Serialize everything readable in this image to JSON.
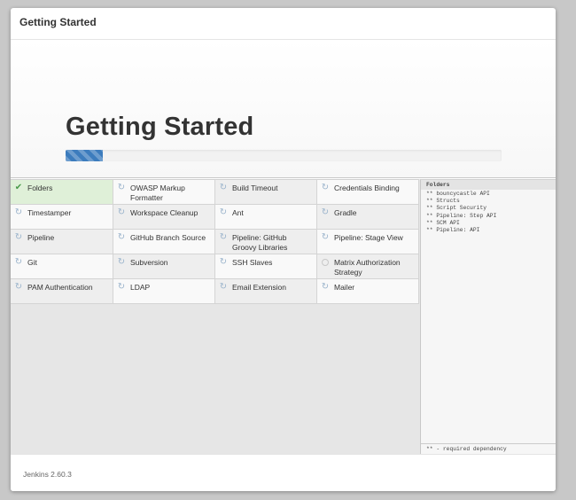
{
  "header": {
    "title": "Getting Started"
  },
  "hero": {
    "title": "Getting Started",
    "progress_fraction": 0.085
  },
  "plugins": [
    {
      "label": "Folders",
      "status": "done",
      "icon": "check-icon"
    },
    {
      "label": "OWASP Markup Formatter",
      "status": "installing",
      "icon": "refresh-icon"
    },
    {
      "label": "Build Timeout",
      "status": "installing",
      "icon": "refresh-icon"
    },
    {
      "label": "Credentials Binding",
      "status": "installing",
      "icon": "refresh-icon"
    },
    {
      "label": "Timestamper",
      "status": "installing",
      "icon": "refresh-icon"
    },
    {
      "label": "Workspace Cleanup",
      "status": "installing",
      "icon": "refresh-icon"
    },
    {
      "label": "Ant",
      "status": "installing",
      "icon": "refresh-icon"
    },
    {
      "label": "Gradle",
      "status": "installing",
      "icon": "refresh-icon"
    },
    {
      "label": "Pipeline",
      "status": "installing",
      "icon": "refresh-icon"
    },
    {
      "label": "GitHub Branch Source",
      "status": "installing",
      "icon": "refresh-icon"
    },
    {
      "label": "Pipeline: GitHub Groovy Libraries",
      "status": "installing",
      "icon": "refresh-icon"
    },
    {
      "label": "Pipeline: Stage View",
      "status": "installing",
      "icon": "refresh-icon"
    },
    {
      "label": "Git",
      "status": "installing",
      "icon": "refresh-icon"
    },
    {
      "label": "Subversion",
      "status": "installing",
      "icon": "refresh-icon"
    },
    {
      "label": "SSH Slaves",
      "status": "installing",
      "icon": "refresh-icon"
    },
    {
      "label": "Matrix Authorization Strategy",
      "status": "pending",
      "icon": "pending-circle-icon"
    },
    {
      "label": "PAM Authentication",
      "status": "installing",
      "icon": "refresh-icon"
    },
    {
      "label": "LDAP",
      "status": "installing",
      "icon": "refresh-icon"
    },
    {
      "label": "Email Extension",
      "status": "installing",
      "icon": "refresh-icon"
    },
    {
      "label": "Mailer",
      "status": "installing",
      "icon": "refresh-icon"
    }
  ],
  "log": {
    "title": "Folders",
    "lines": [
      "** bouncycastle API",
      "** Structs",
      "** Script Security",
      "** Pipeline: Step API",
      "** SCM API",
      "** Pipeline: API"
    ],
    "footer": "** - required dependency"
  },
  "footer": {
    "version": "Jenkins 2.60.3"
  },
  "colors": {
    "accent": "#3c7cbd",
    "done_bg": "#dff0d8",
    "check": "#4a9b4a",
    "spinner": "#9bb4cc"
  }
}
